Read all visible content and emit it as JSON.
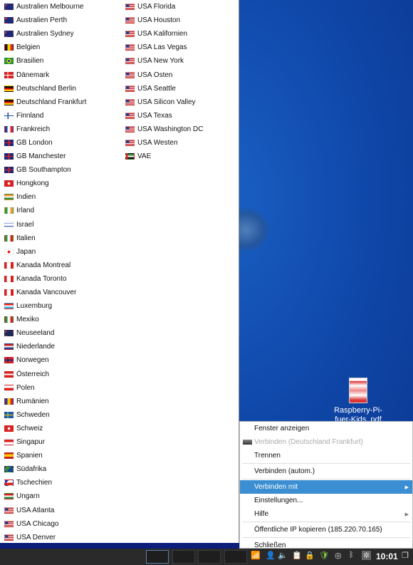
{
  "server_list": {
    "column1": [
      {
        "label": "Australien Melbourne",
        "flag": "flag-au"
      },
      {
        "label": "Australien Perth",
        "flag": "flag-au"
      },
      {
        "label": "Australien Sydney",
        "flag": "flag-au"
      },
      {
        "label": "Belgien",
        "flag": "flag-be"
      },
      {
        "label": "Brasilien",
        "flag": "flag-br"
      },
      {
        "label": "Dänemark",
        "flag": "flag-dk"
      },
      {
        "label": "Deutschland Berlin",
        "flag": "flag-de"
      },
      {
        "label": "Deutschland Frankfurt",
        "flag": "flag-de"
      },
      {
        "label": "Finnland",
        "flag": "flag-fi"
      },
      {
        "label": "Frankreich",
        "flag": "flag-fr"
      },
      {
        "label": "GB London",
        "flag": "flag-gb"
      },
      {
        "label": "GB Manchester",
        "flag": "flag-gb"
      },
      {
        "label": "GB Southampton",
        "flag": "flag-gb"
      },
      {
        "label": "Hongkong",
        "flag": "flag-hk"
      },
      {
        "label": "Indien",
        "flag": "flag-in"
      },
      {
        "label": "Irland",
        "flag": "flag-ie"
      },
      {
        "label": "Israel",
        "flag": "flag-il"
      },
      {
        "label": "Italien",
        "flag": "flag-it"
      },
      {
        "label": "Japan",
        "flag": "flag-jp"
      },
      {
        "label": "Kanada Montreal",
        "flag": "flag-ca"
      },
      {
        "label": "Kanada Toronto",
        "flag": "flag-ca"
      },
      {
        "label": "Kanada Vancouver",
        "flag": "flag-ca"
      },
      {
        "label": "Luxemburg",
        "flag": "flag-lu"
      },
      {
        "label": "Mexiko",
        "flag": "flag-mx"
      },
      {
        "label": "Neuseeland",
        "flag": "flag-nz"
      },
      {
        "label": "Niederlande",
        "flag": "flag-nl"
      },
      {
        "label": "Norwegen",
        "flag": "flag-no"
      },
      {
        "label": "Österreich",
        "flag": "flag-at"
      },
      {
        "label": "Polen",
        "flag": "flag-pl"
      },
      {
        "label": "Rumänien",
        "flag": "flag-ro"
      },
      {
        "label": "Schweden",
        "flag": "flag-se"
      },
      {
        "label": "Schweiz",
        "flag": "flag-ch"
      },
      {
        "label": "Singapur",
        "flag": "flag-sg"
      },
      {
        "label": "Spanien",
        "flag": "flag-es"
      },
      {
        "label": "Südafrika",
        "flag": "flag-za"
      },
      {
        "label": "Tschechien",
        "flag": "flag-cz"
      },
      {
        "label": "Ungarn",
        "flag": "flag-hu"
      },
      {
        "label": "USA Atlanta",
        "flag": "flag-us"
      },
      {
        "label": "USA Chicago",
        "flag": "flag-us"
      },
      {
        "label": "USA Denver",
        "flag": "flag-us"
      }
    ],
    "column2": [
      {
        "label": "USA Florida",
        "flag": "flag-us"
      },
      {
        "label": "USA Houston",
        "flag": "flag-us"
      },
      {
        "label": "USA Kalifornien",
        "flag": "flag-us"
      },
      {
        "label": "USA Las Vegas",
        "flag": "flag-us"
      },
      {
        "label": "USA New York",
        "flag": "flag-us"
      },
      {
        "label": "USA Osten",
        "flag": "flag-us"
      },
      {
        "label": "USA Seattle",
        "flag": "flag-us"
      },
      {
        "label": "USA Silicon Valley",
        "flag": "flag-us"
      },
      {
        "label": "USA Texas",
        "flag": "flag-us"
      },
      {
        "label": "USA Washington DC",
        "flag": "flag-us"
      },
      {
        "label": "USA Westen",
        "flag": "flag-us"
      },
      {
        "label": "VAE",
        "flag": "flag-ae"
      }
    ]
  },
  "context_menu": {
    "show_window": "Fenster anzeigen",
    "connect_last": "Verbinden (Deutschland Frankfurt)",
    "disconnect": "Trennen",
    "connect_auto": "Verbinden (autom.)",
    "connect_to": "Verbinden mit",
    "settings": "Einstellungen...",
    "help": "Hilfe",
    "copy_ip": "Öffentliche IP kopieren (185.220.70.165)",
    "close": "Schließen",
    "highlight_color": "#3a8ed1"
  },
  "desktop": {
    "file_label": "Raspberry-Pi-fuer-Kids..pdf"
  },
  "taskbar": {
    "clock": "10:01"
  }
}
